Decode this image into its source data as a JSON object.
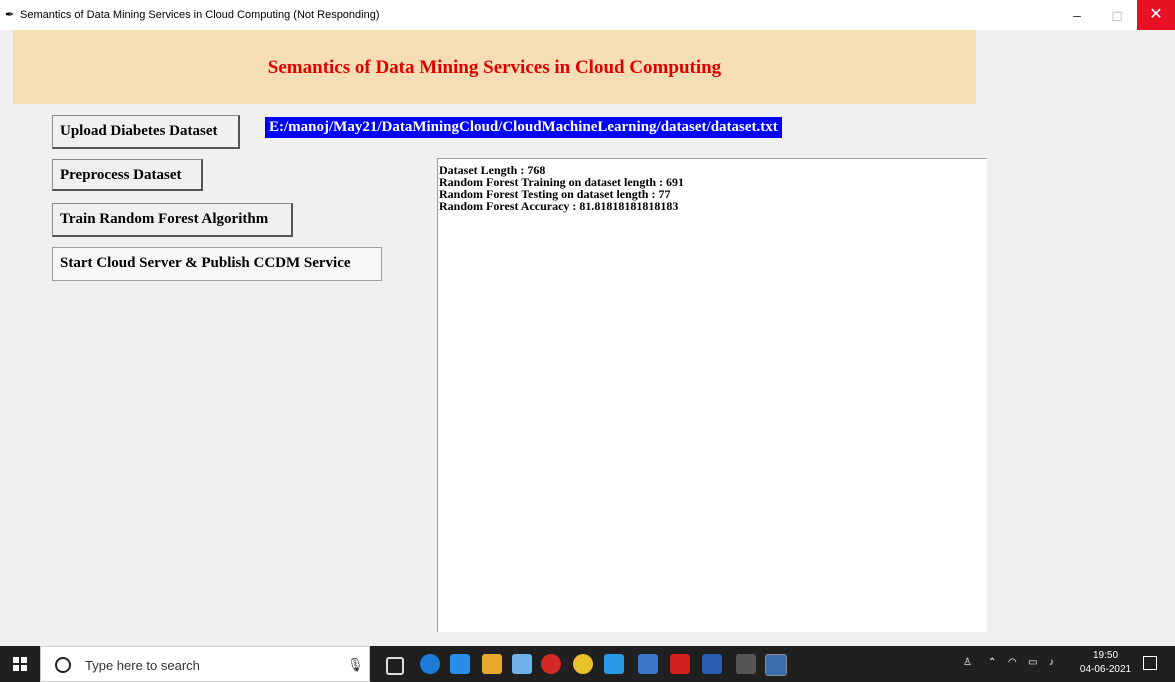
{
  "window": {
    "title": "Semantics of Data Mining Services in Cloud Computing (Not Responding)",
    "controls": {
      "minimize": "–",
      "maximize": "◻",
      "close": "✕"
    }
  },
  "header": {
    "title": "Semantics of Data Mining Services in Cloud Computing"
  },
  "buttons": {
    "upload": "Upload Diabetes Dataset",
    "preprocess": "Preprocess Dataset",
    "train": "Train Random Forest Algorithm",
    "cloud": "Start Cloud Server & Publish CCDM Service"
  },
  "path_label": "E:/manoj/May21/DataMiningCloud/CloudMachineLearning/dataset/dataset.txt",
  "output": {
    "lines": [
      "Dataset Length : 768",
      "Random Forest Training on dataset length : 691",
      "Random Forest Testing on dataset length : 77",
      "Random Forest Accuracy : 81.81818181818183"
    ]
  },
  "taskbar": {
    "search_placeholder": "Type here to search",
    "time": "19:50",
    "date": "04-06-2021",
    "icons": [
      "task-view-icon",
      "edge-icon",
      "mail-icon",
      "store-icon",
      "app-icon",
      "opera-icon",
      "chrome-icon",
      "explorer-icon",
      "files-icon",
      "acrobat-icon",
      "word-icon",
      "terminal-icon",
      "python-icon"
    ]
  },
  "colors": {
    "header_bg": "#f5deb3",
    "header_text": "#e00000",
    "path_bg": "#0000ff"
  }
}
